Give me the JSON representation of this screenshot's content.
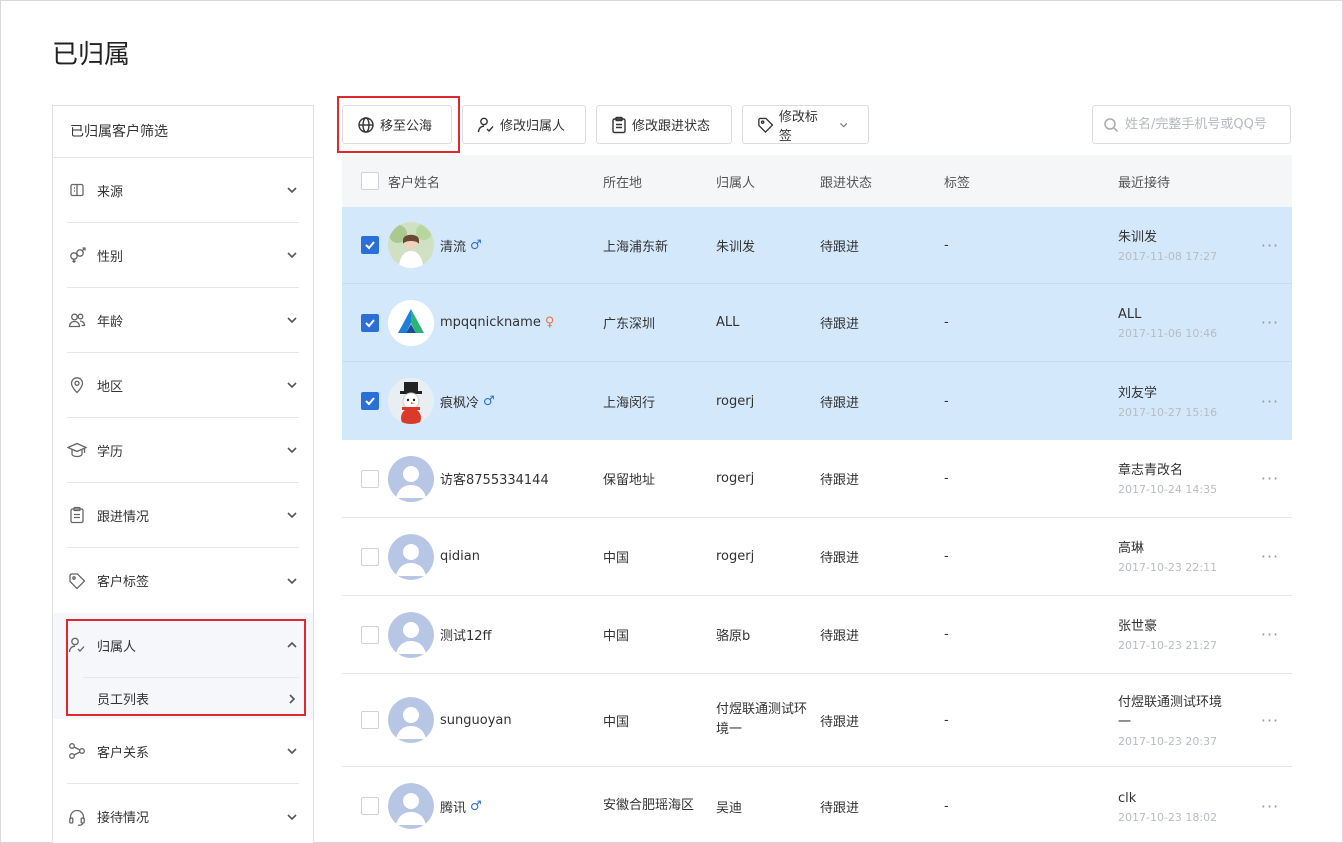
{
  "page": {
    "title": "已归属"
  },
  "sidebar": {
    "header": "已归属客户筛选",
    "filters": [
      {
        "label": "来源",
        "icon": "source-icon"
      },
      {
        "label": "性别",
        "icon": "gender-icon"
      },
      {
        "label": "年龄",
        "icon": "people-icon"
      },
      {
        "label": "地区",
        "icon": "location-pin-icon"
      },
      {
        "label": "学历",
        "icon": "graduation-cap-icon"
      },
      {
        "label": "跟进情况",
        "icon": "clipboard-icon"
      },
      {
        "label": "客户标签",
        "icon": "tag-icon"
      }
    ],
    "owner_filter": {
      "label": "归属人",
      "sub_item": "员工列表"
    },
    "filters_after": [
      {
        "label": "客户关系",
        "icon": "relation-icon"
      },
      {
        "label": "接待情况",
        "icon": "headset-icon"
      }
    ]
  },
  "toolbar": {
    "move_to_pool": "移至公海",
    "change_owner": "修改归属人",
    "change_status": "修改跟进状态",
    "change_tags": "修改标签",
    "search_placeholder": "姓名/完整手机号或QQ号"
  },
  "table": {
    "headers": {
      "name": "客户姓名",
      "location": "所在地",
      "owner": "归属人",
      "status": "跟进状态",
      "tags": "标签",
      "recent": "最近接待"
    },
    "rows": [
      {
        "checked": true,
        "avatar": "photo-woman",
        "name": "清流",
        "gender": "male",
        "gender_symbol": "♂",
        "location": "上海浦东新",
        "owner": "朱训发",
        "status": "待跟进",
        "tags": "-",
        "recent_name": "朱训发",
        "recent_time": "2017-11-08 17:27"
      },
      {
        "checked": true,
        "avatar": "logo-a",
        "name": "mpqqnickname",
        "gender": "female",
        "gender_symbol": "♀",
        "location": "广东深圳",
        "owner": "ALL",
        "status": "待跟进",
        "tags": "-",
        "recent_name": "ALL",
        "recent_time": "2017-11-06 10:46"
      },
      {
        "checked": true,
        "avatar": "snowman",
        "name": "痕枫冷",
        "gender": "male",
        "gender_symbol": "♂",
        "location": "上海闵行",
        "owner": "rogerj",
        "status": "待跟进",
        "tags": "-",
        "recent_name": "刘友学",
        "recent_time": "2017-10-27 15:16"
      },
      {
        "checked": false,
        "avatar": "default",
        "name": "访客8755334144",
        "gender": "",
        "gender_symbol": "",
        "location": "保留地址",
        "owner": "rogerj",
        "status": "待跟进",
        "tags": "-",
        "recent_name": "章志青改名",
        "recent_time": "2017-10-24 14:35"
      },
      {
        "checked": false,
        "avatar": "default",
        "name": "qidian",
        "gender": "",
        "gender_symbol": "",
        "location": "中国",
        "owner": "rogerj",
        "status": "待跟进",
        "tags": "-",
        "recent_name": "高琳",
        "recent_time": "2017-10-23 22:11"
      },
      {
        "checked": false,
        "avatar": "default",
        "name": "测试12ff",
        "gender": "",
        "gender_symbol": "",
        "location": "中国",
        "owner": "骆原b",
        "status": "待跟进",
        "tags": "-",
        "recent_name": "张世豪",
        "recent_time": "2017-10-23 21:27"
      },
      {
        "checked": false,
        "avatar": "default",
        "name": "sunguoyan",
        "gender": "",
        "gender_symbol": "",
        "location": "中国",
        "owner": "付煜联通测试环境一",
        "status": "待跟进",
        "tags": "-",
        "recent_name": "付煜联通测试环境一",
        "recent_time": "2017-10-23 20:37"
      },
      {
        "checked": false,
        "avatar": "default",
        "name": "腾讯",
        "gender": "male",
        "gender_symbol": "♂",
        "location": "安徽合肥瑶海区",
        "owner": "吴迪",
        "status": "待跟进",
        "tags": "-",
        "recent_name": "clk",
        "recent_time": "2017-10-23 18:02"
      }
    ],
    "more_label": "···"
  },
  "colors": {
    "accent": "#2a6fd6",
    "selected_row": "#d4e8fc",
    "highlight_box": "#e0282e",
    "female": "#e8734a"
  }
}
